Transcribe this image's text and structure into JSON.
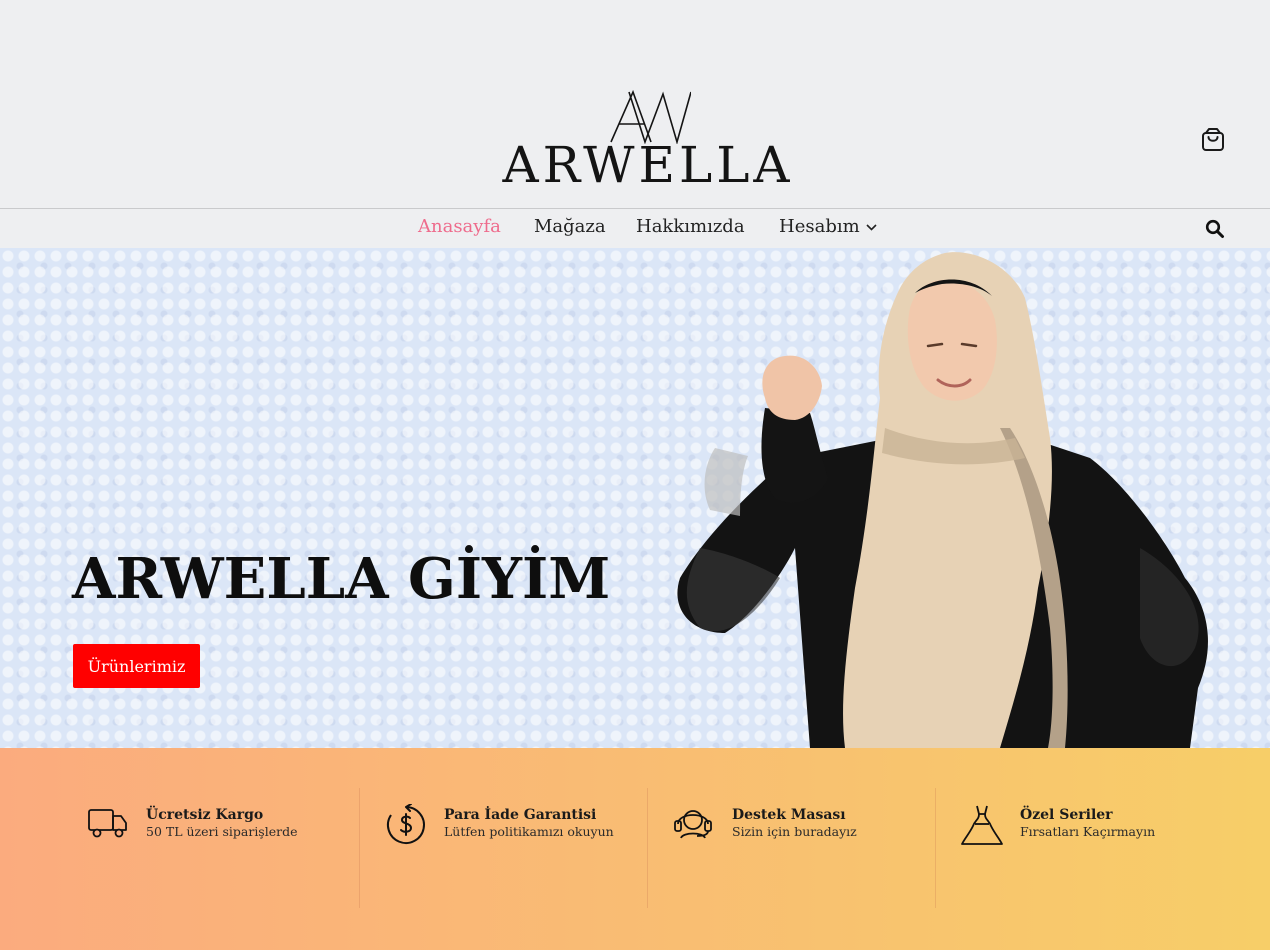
{
  "brand": {
    "monogram": "AW",
    "name": "ARWELLA"
  },
  "nav": {
    "items": [
      {
        "label": "Anasayfa",
        "active": true
      },
      {
        "label": "Mağaza",
        "active": false
      },
      {
        "label": "Hakkımızda",
        "active": false
      },
      {
        "label": "Hesabım",
        "active": false,
        "has_dropdown": true
      }
    ]
  },
  "icons": {
    "cart": "shopping-bag-icon",
    "search": "search-icon",
    "dropdown": "chevron-down-icon"
  },
  "hero": {
    "title": "ARWELLA GİYİM",
    "button_label": "Ürünlerimiz"
  },
  "features": [
    {
      "icon": "truck-icon",
      "title": "Ücretsiz Kargo",
      "subtitle": "50 TL üzeri siparişlerde"
    },
    {
      "icon": "money-back-icon",
      "title": "Para İade Garantisi",
      "subtitle": "Lütfen politikamızı okuyun"
    },
    {
      "icon": "headset-icon",
      "title": "Destek Masası",
      "subtitle": "Sizin için buradayız"
    },
    {
      "icon": "dress-icon",
      "title": "Özel Seriler",
      "subtitle": "Fırsatları Kaçırmayın"
    }
  ],
  "colors": {
    "accent_nav": "#ee6b8c",
    "hero_button": "#ff0000",
    "gradient_start": "#fbab7e",
    "gradient_end": "#f7ce68"
  }
}
